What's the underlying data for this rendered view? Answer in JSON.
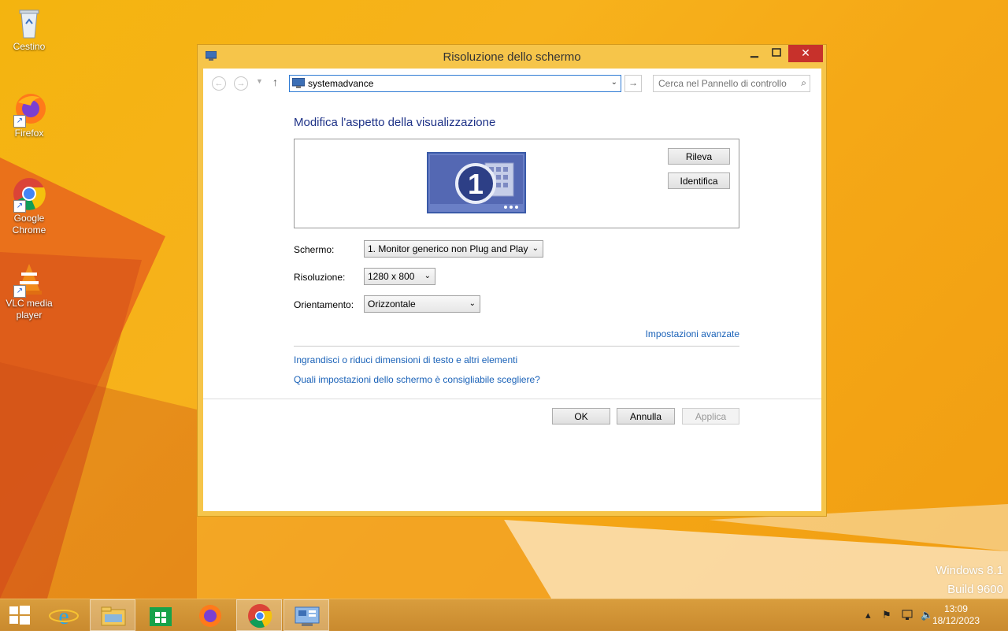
{
  "desktop": {
    "icons": [
      {
        "label": "Cestino"
      },
      {
        "label": "Firefox"
      },
      {
        "label": "Google Chrome"
      },
      {
        "label": "VLC media player"
      }
    ],
    "watermark": {
      "line1": "Windows 8.1",
      "line2": "Build 9600"
    }
  },
  "window": {
    "title": "Risoluzione dello schermo",
    "address": {
      "value": "systemadvance"
    },
    "search": {
      "placeholder": "Cerca nel Pannello di controllo"
    },
    "heading": "Modifica l'aspetto della visualizzazione",
    "monitor_number": "1",
    "buttons": {
      "detect": "Rileva",
      "identify": "Identifica",
      "ok": "OK",
      "cancel": "Annulla",
      "apply": "Applica"
    },
    "fields": {
      "display": {
        "label": "Schermo:",
        "value": "1. Monitor generico non Plug and Play"
      },
      "resolution": {
        "label": "Risoluzione:",
        "value": "1280 x 800"
      },
      "orientation": {
        "label": "Orientamento:",
        "value": "Orizzontale"
      }
    },
    "links": {
      "advanced": "Impostazioni avanzate",
      "text_size": "Ingrandisci o riduci dimensioni di testo e altri elementi",
      "which_settings": "Quali impostazioni dello schermo è consigliabile scegliere?"
    }
  },
  "taskbar": {
    "apps": [
      "start-button",
      "internet-explorer",
      "file-explorer",
      "store",
      "firefox",
      "chrome",
      "control-panel"
    ],
    "clock": {
      "time": "13:09",
      "date": "18/12/2023"
    }
  }
}
